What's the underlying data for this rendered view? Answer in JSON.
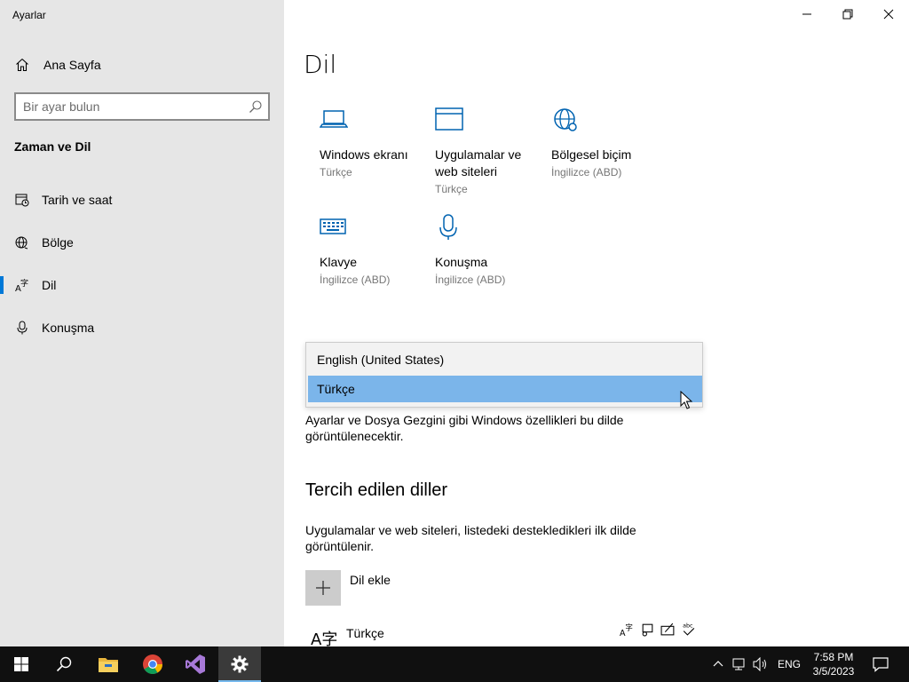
{
  "window": {
    "title": "Ayarlar"
  },
  "sidebar": {
    "home_label": "Ana Sayfa",
    "search_placeholder": "Bir ayar bulun",
    "section_title": "Zaman ve Dil",
    "items": [
      {
        "label": "Tarih ve saat",
        "icon": "calendar-clock-icon"
      },
      {
        "label": "Bölge",
        "icon": "globe-icon"
      },
      {
        "label": "Dil",
        "icon": "language-icon",
        "active": true
      },
      {
        "label": "Konuşma",
        "icon": "microphone-icon"
      }
    ]
  },
  "main": {
    "title": "Dil",
    "tiles": [
      {
        "name": "Windows ekranı",
        "sub": "Türkçe",
        "icon": "laptop-icon"
      },
      {
        "name": "Uygulamalar ve web siteleri",
        "sub": "Türkçe",
        "icon": "window-icon"
      },
      {
        "name": "Bölgesel biçim",
        "sub": "İngilizce (ABD)",
        "icon": "globe-settings-icon"
      },
      {
        "name": "Klavye",
        "sub": "İngilizce (ABD)",
        "icon": "keyboard-icon"
      },
      {
        "name": "Konuşma",
        "sub": "İngilizce (ABD)",
        "icon": "microphone-icon"
      }
    ],
    "dropdown_options": [
      "English (United States)",
      "Türkçe"
    ],
    "dropdown_selected": "Türkçe",
    "display_language_desc": "Ayarlar ve Dosya Gezgini gibi Windows özellikleri bu dilde görüntülenecektir.",
    "preferred_heading": "Tercih edilen diller",
    "preferred_desc": "Uygulamalar ve web siteleri, listedeki destekledikleri ilk dilde görüntülenir.",
    "add_language_label": "Dil ekle",
    "languages": [
      {
        "name": "Türkçe",
        "glyph": "A字"
      }
    ]
  },
  "taskbar": {
    "tray_language": "ENG",
    "time": "7:58 PM",
    "date": "3/5/2023"
  },
  "colors": {
    "accent": "#0078d7",
    "icon_blue": "#0063b1",
    "selection": "#7bb5ea",
    "taskbar": "#101010"
  }
}
